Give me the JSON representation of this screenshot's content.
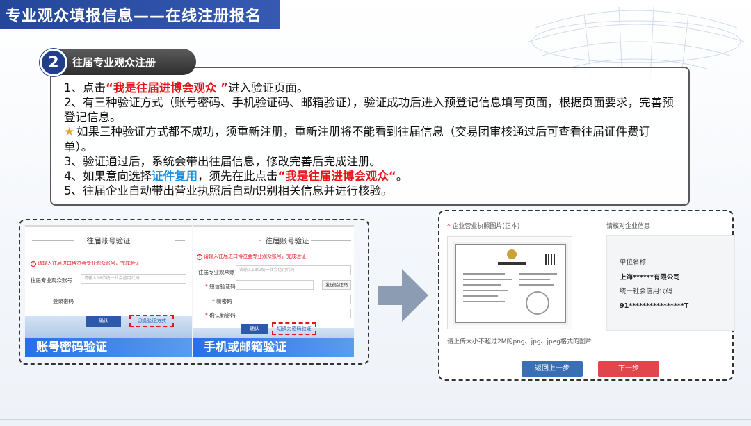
{
  "header": {
    "title": "专业观众填报信息——在线注册报名"
  },
  "step": {
    "number": "2",
    "label": "往届专业观众注册"
  },
  "instructions": {
    "l1_pre": "1、点击",
    "l1_red": "“我是往届进博会观众 ”",
    "l1_post": "进入验证页面。",
    "l2": "2、有三种验证方式（账号密码、手机验证码、邮箱验证），验证成功后进入预登记信息填写页面，根据页面要求，完善预登记信息。",
    "l3": "如果三种验证方式都不成功，须重新注册，重新注册将不能看到往届信息（交易团审核通过后可查看往届证件费订单）。",
    "l4": "3、验证通过后，系统会带出往届信息，修改完善后完成注册。",
    "l5_pre": "4、如果意向选择",
    "l5_blue": "证件复用",
    "l5_mid": "，须先在此点击",
    "l5_red": "“我是往届进博会观众“",
    "l5_post": "。",
    "l6": "5、往届企业自动带出营业执照后自动识别相关信息并进行核验。"
  },
  "account_shot": {
    "title": "往届账号验证",
    "warning": "请输入往届进口博览会专业观众账号，完成验证",
    "account_label": "往届专业观众账号",
    "account_placeholder": "请输入18位统一社会信用代码",
    "password_label": "登录密码",
    "confirm": "确认",
    "switch": "切换验证方式",
    "caption": "账号密码验证"
  },
  "phone_shot": {
    "title": "往届账号验证",
    "warning": "请输入往届进口博览会专业观众账号，完成验证",
    "account_label": "往届专业观众账号",
    "account_placeholder": "请输入18位统一社会信用代码",
    "sms_label": "短信验证码",
    "sms_button": "发送验证码",
    "newpwd_label": "新密码",
    "confirmpwd_label": "确认新密码",
    "confirm": "确认",
    "switch": "切换为密码验证",
    "caption": "手机或邮箱验证"
  },
  "verify_panel": {
    "license_label": "企业营业执照图片(正本)",
    "check_label": "请核对企业信息",
    "unit_name_label": "单位名称",
    "unit_name_value": "上海******有限公司",
    "credit_code_label": "统一社会信用代码",
    "credit_code_value": "91****************T",
    "upload_hint": "请上传大小不超过2M的png、jpg、jpeg格式的图片",
    "back_button": "返回上一步",
    "next_button": "下一步"
  },
  "colors": {
    "title_blue": "#24479a",
    "red": "#e5141b",
    "blue": "#1f8fe0"
  }
}
